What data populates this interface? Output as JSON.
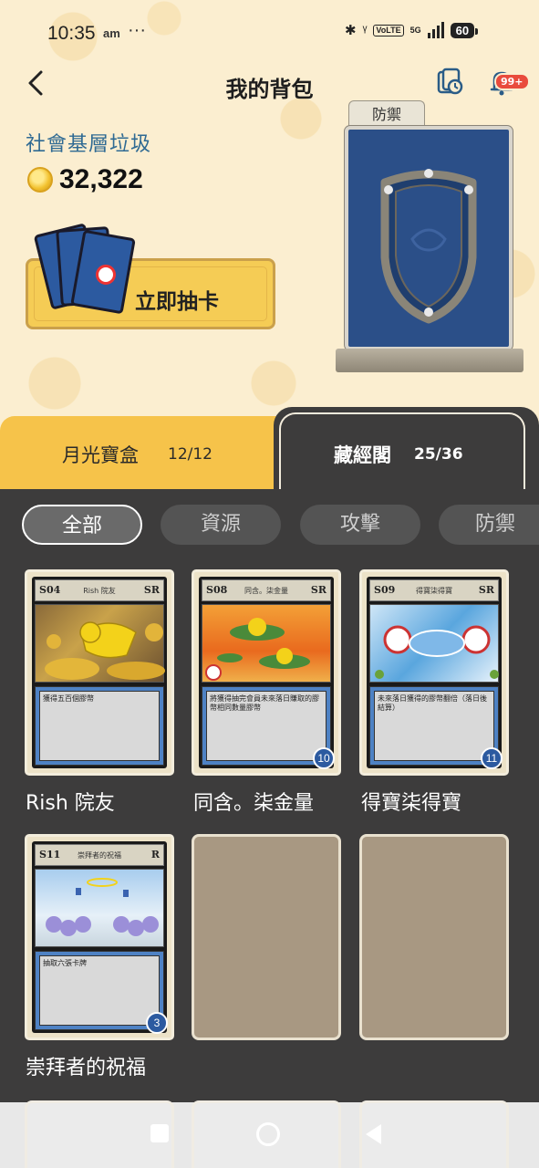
{
  "status_bar": {
    "time": "10:35",
    "ampm": "am",
    "overflow": "···",
    "volte": "VoLTE",
    "network": "5G",
    "battery": "60"
  },
  "header": {
    "back_icon": "chevron-left-icon",
    "title": "我的背包",
    "notification_badge": "99+"
  },
  "profile": {
    "username": "社會基層垃圾",
    "coins": "32,322"
  },
  "draw_button": {
    "label": "立即抽卡"
  },
  "featured_card": {
    "type_label": "防禦"
  },
  "tabs": [
    {
      "label": "月光寶盒",
      "count": "12/12"
    },
    {
      "label": "藏經閣",
      "count": "25/36"
    }
  ],
  "filters": [
    "全部",
    "資源",
    "攻擊",
    "防禦"
  ],
  "cards": [
    {
      "code": "S04",
      "title": "Rish 院友",
      "rarity": "SR",
      "desc": "獲得五百個膠幣",
      "name": "Rish 院友",
      "count": ""
    },
    {
      "code": "S08",
      "title": "同含。柒金量",
      "rarity": "SR",
      "desc": "將獲得抽完會員未來落日賺取的膠幣相同數量膠幣",
      "name": "同含。柒金量",
      "count": "10"
    },
    {
      "code": "S09",
      "title": "得寶柒得寶",
      "rarity": "SR",
      "desc": "未來落日獲得的膠幣翻倍（落日後結算）",
      "name": "得寶柒得寶",
      "count": "11"
    },
    {
      "code": "S11",
      "title": "崇拜者的祝福",
      "rarity": "R",
      "desc": "抽取六張卡牌",
      "name": "崇拜者的祝福",
      "count": "3"
    }
  ],
  "colors": {
    "accent_gold": "#f6c34a",
    "panel_dark": "#3d3c3c",
    "username_blue": "#2f6a93",
    "badge_red": "#e94b3c"
  }
}
